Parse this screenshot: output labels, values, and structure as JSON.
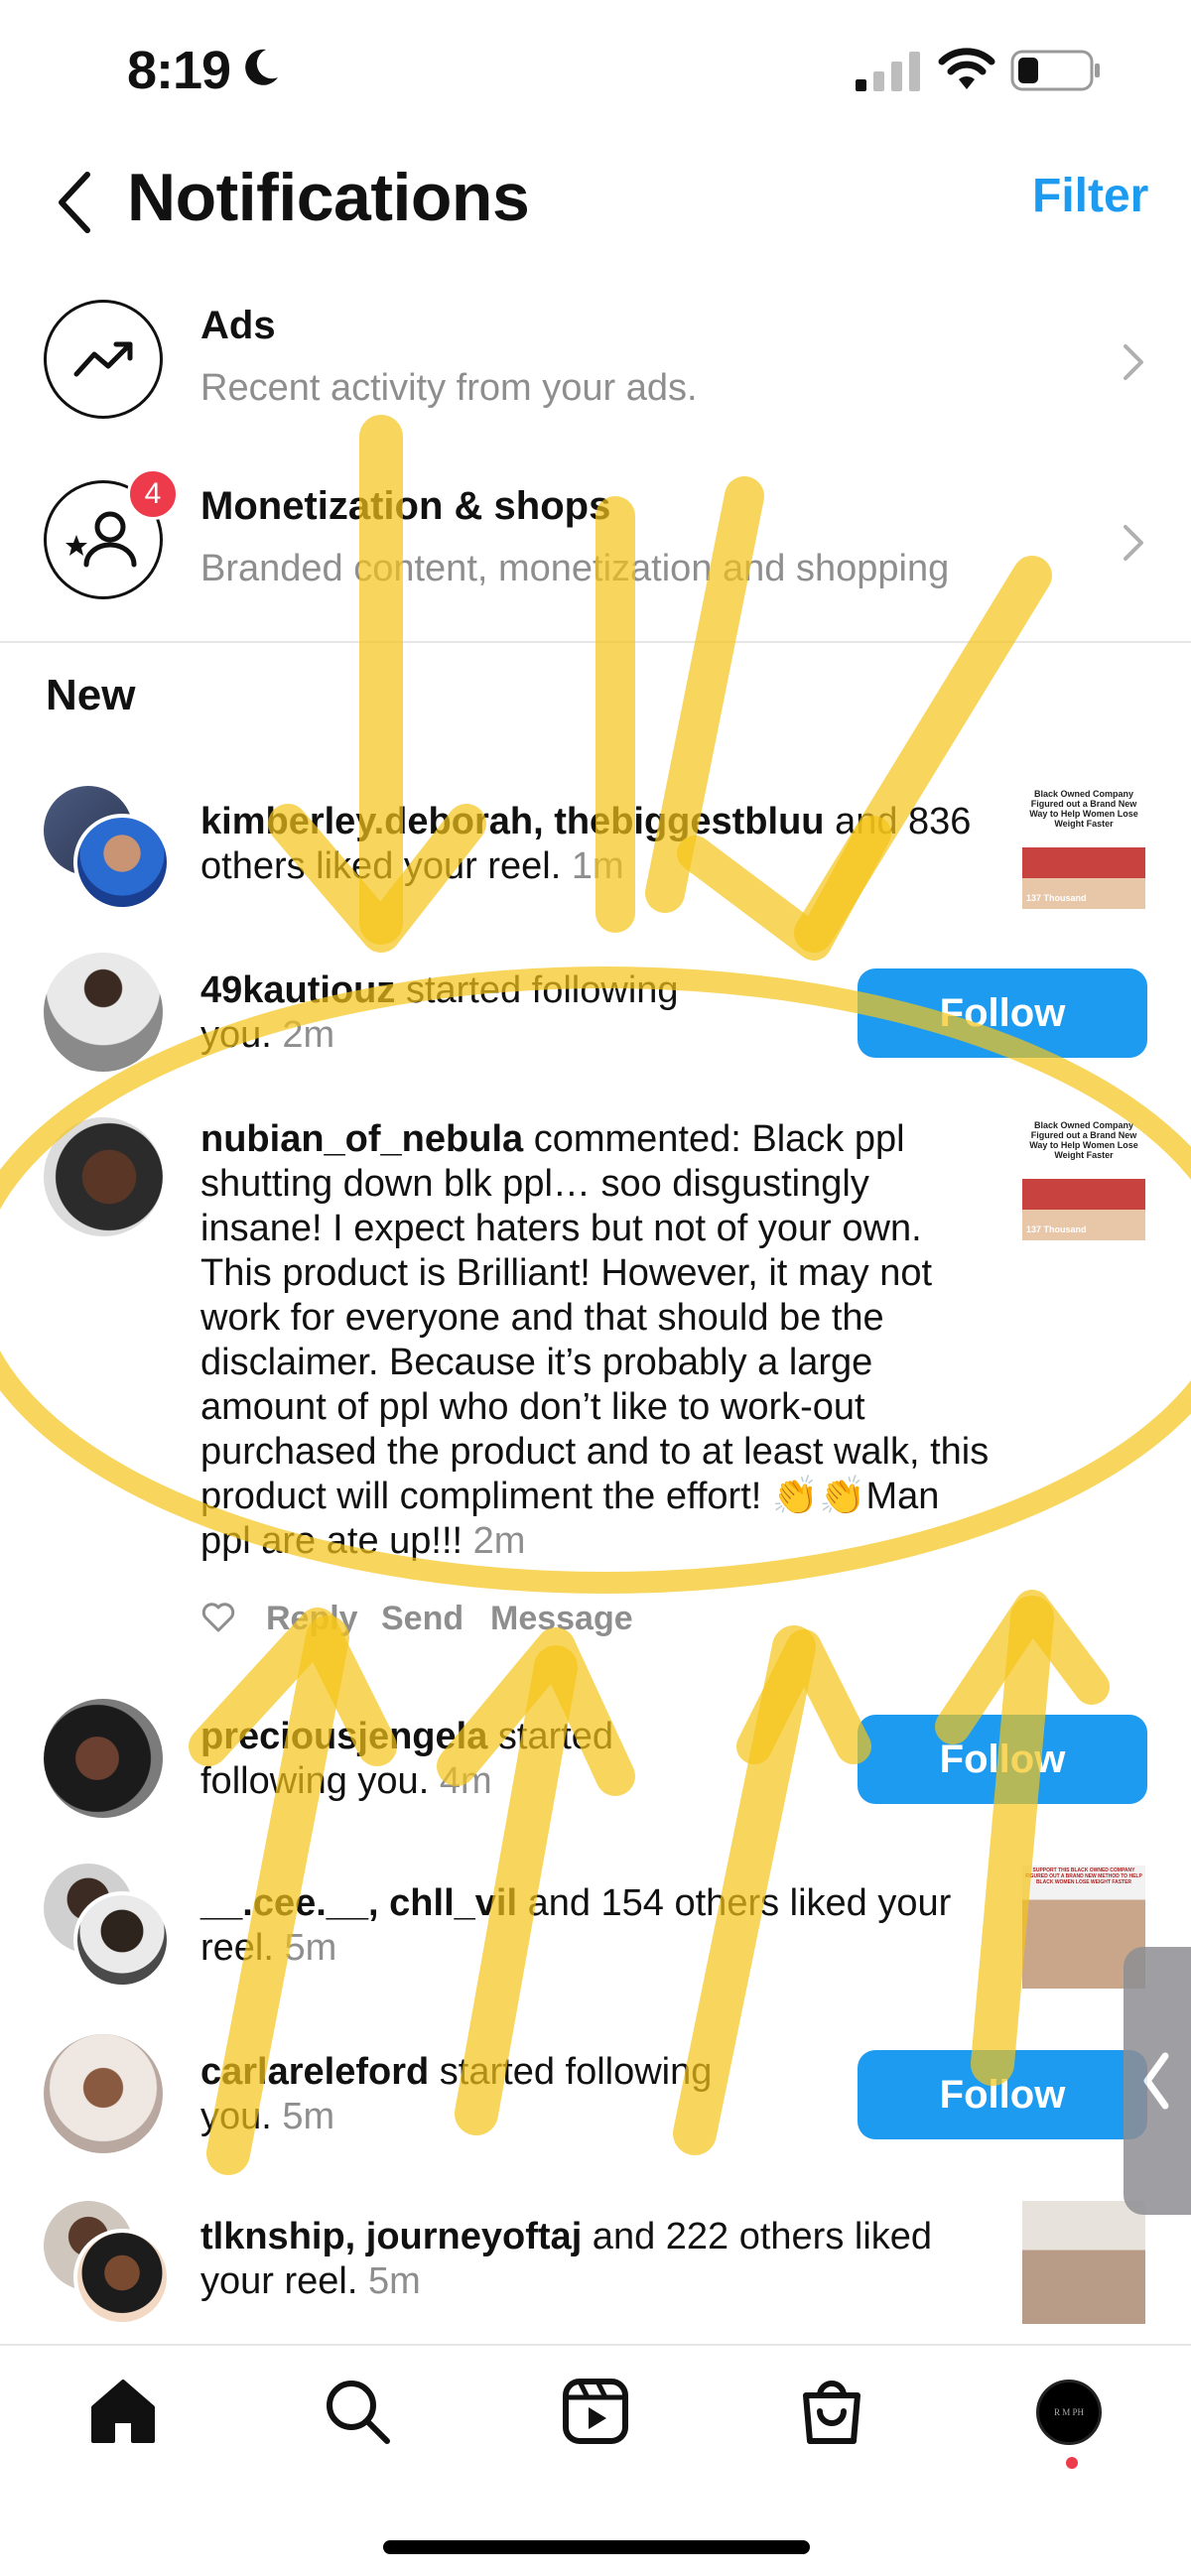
{
  "status_bar": {
    "time": "8:19"
  },
  "header": {
    "title": "Notifications",
    "filter_label": "Filter"
  },
  "sections": [
    {
      "title": "Ads",
      "subtitle": "Recent activity from your ads.",
      "icon": "trending-up-icon"
    },
    {
      "title": "Monetization & shops",
      "subtitle": "Branded content, monetization and shopping",
      "icon": "star-person-icon",
      "badge": "4"
    }
  ],
  "new_label": "New",
  "notifications": [
    {
      "type": "like",
      "names": "kimberley.deborah, thebiggestbluu",
      "rest": " and 836 others liked your reel.",
      "time": "1m",
      "thumb_text": "Black Owned Company Figured out a Brand New Way to Help Women Lose Weight Faster",
      "thumb_count": "137 Thousand"
    },
    {
      "type": "follow",
      "name": "49kautiouz",
      "rest": " started following you.",
      "time": "2m",
      "button": "Follow"
    },
    {
      "type": "comment",
      "name": "nubian_of_nebula",
      "text": " commented: Black ppl shutting down blk ppl… soo disgustingly insane! I expect haters but not of your own. This product is Brilliant! However, it may not work for everyone and that should be the disclaimer. Because it’s probably a large amount of ppl who don’t like to work-out purchased the product and to at least walk, this product will compliment the effort! 👏👏Man ppl are ate up!!!",
      "time": "2m",
      "thumb_text": "Black Owned Company Figured out a Brand New Way to Help Women Lose Weight Faster",
      "thumb_count": "137 Thousand",
      "actions": {
        "reply": "Reply",
        "send": "Send",
        "message": "Message"
      }
    },
    {
      "type": "follow",
      "name": "preciousjengela",
      "rest": " started following you.",
      "time": "4m",
      "button": "Follow"
    },
    {
      "type": "like",
      "names": "__.cee.__, chll_vil",
      "rest": " and 154 others liked your reel.",
      "time": "5m",
      "thumb_text": "SUPPORT THIS BLACK OWNED COMPANY FIGURED OUT A BRAND NEW METHOD TO HELP BLACK WOMEN LOSE WEIGHT FASTER"
    },
    {
      "type": "follow",
      "name": "carlareleford",
      "rest": " started following you.",
      "time": "5m",
      "button": "Follow"
    },
    {
      "type": "like",
      "names": "tlknship, journeyoftaj",
      "rest": " and 222 others liked your reel.",
      "time": "5m"
    }
  ],
  "profile_initials": "R M PH",
  "colors": {
    "accent": "#1d9bf0",
    "badge": "#ed3b4c",
    "highlighter": "#f5c518",
    "muted": "#8e8e8e"
  },
  "tabs": [
    "home-icon",
    "search-icon",
    "reels-icon",
    "shop-icon",
    "profile-avatar"
  ]
}
